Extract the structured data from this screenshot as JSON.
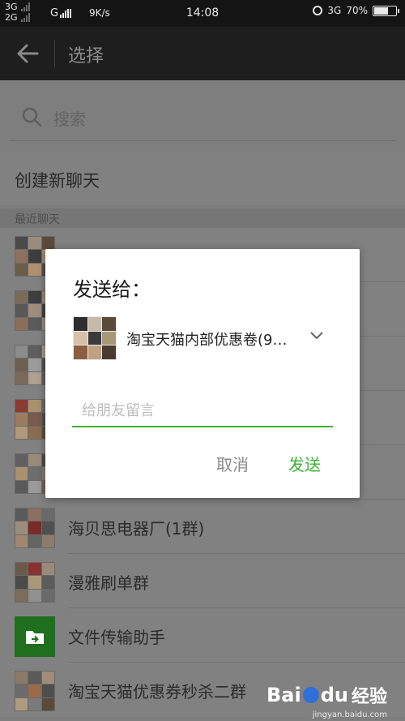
{
  "status_bar": {
    "net1": "3G",
    "net2": "2G",
    "net3": "G",
    "speed": "9K/s",
    "time": "14:08",
    "net4": "3G",
    "battery_text": "70%",
    "battery_level": 0.7
  },
  "titlebar": {
    "title": "选择"
  },
  "search": {
    "placeholder": "搜索"
  },
  "new_chat": "创建新聊天",
  "section_label": "最近聊天",
  "rows": [
    {
      "name": ""
    },
    {
      "name": ""
    },
    {
      "name": ""
    },
    {
      "name": ""
    },
    {
      "name": ""
    },
    {
      "name": "海贝思电器厂(1群)"
    },
    {
      "name": "漫雅刷单群"
    },
    {
      "name": "文件传输助手"
    },
    {
      "name": "淘宝天猫优惠券秒杀二群"
    }
  ],
  "dialog": {
    "title": "发送给：",
    "recipient": "淘宝天猫内部优惠卷(9…",
    "message_placeholder": "给朋友留言",
    "cancel_label": "取消",
    "send_label": "发送"
  },
  "watermark": {
    "logo": "Bai",
    "logo_tail": "du",
    "cn": "经验",
    "url": "jingyan.baidu.com"
  },
  "colors": {
    "accent": "#3cb034",
    "titlebar": "#1e1e1e",
    "dim_page": "#7e7e7e"
  }
}
